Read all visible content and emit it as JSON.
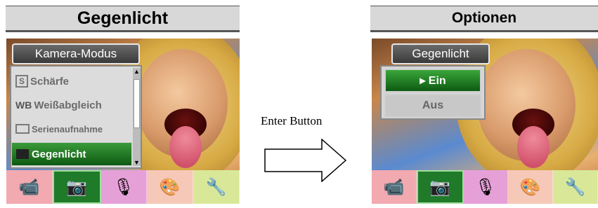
{
  "left_panel": {
    "header": "Gegenlicht",
    "menu_title": "Kamera-Modus",
    "items": [
      {
        "icon_text": "S",
        "label": "Schärfe"
      },
      {
        "icon_text": "WB",
        "label": "Weißabgleich"
      },
      {
        "icon_text": "",
        "label": "Serienaufnahme"
      },
      {
        "icon_text": "",
        "label": "Gegenlicht"
      }
    ],
    "scroll_up": "▲",
    "scroll_down": "▼"
  },
  "right_panel": {
    "header": "Optionen",
    "menu_title": "Gegenlicht",
    "options": [
      {
        "label": "▸ Ein"
      },
      {
        "label": "Aus"
      }
    ]
  },
  "middle": {
    "label": "Enter Button"
  },
  "tabs": [
    {
      "icon": "camcorder-icon",
      "glyph": "📹"
    },
    {
      "icon": "camera-icon",
      "glyph": "📷"
    },
    {
      "icon": "microphone-icon",
      "glyph": "🎙"
    },
    {
      "icon": "palette-icon",
      "glyph": "🎨"
    },
    {
      "icon": "tools-icon",
      "glyph": "🔧"
    }
  ],
  "colors": {
    "selected_green": "#1f7a2a",
    "header_gray": "#d8d8d8"
  }
}
